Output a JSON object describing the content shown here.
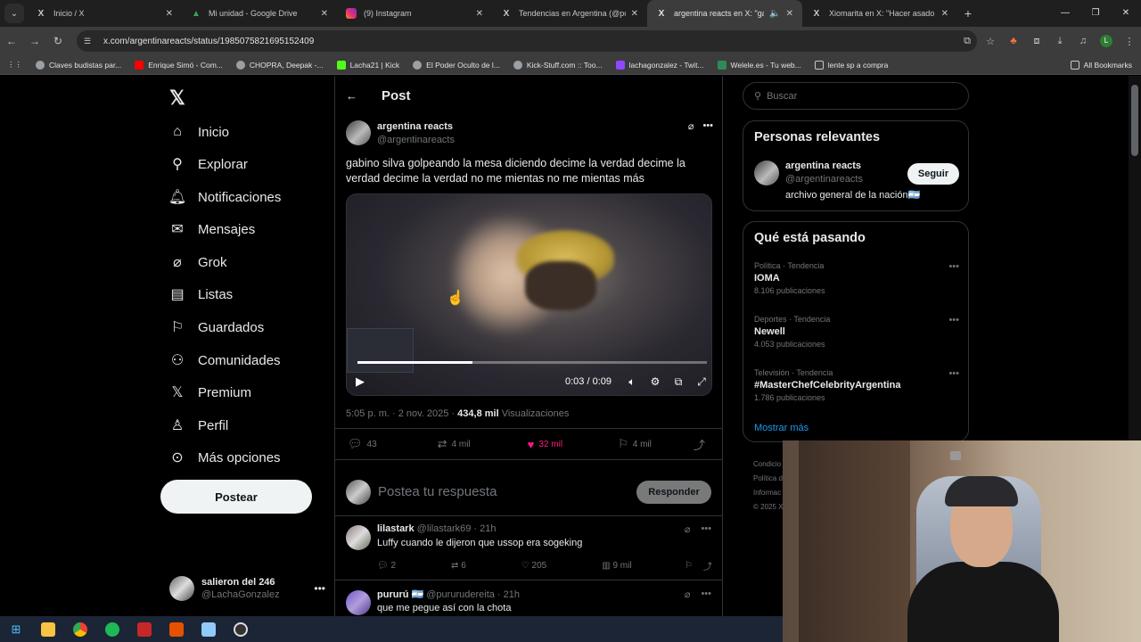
{
  "browser": {
    "tabs": [
      {
        "label": "Inicio / X",
        "icon": "x-logo-icon"
      },
      {
        "label": "Mi unidad - Google Drive",
        "icon": "google-drive-icon"
      },
      {
        "label": "(9) Instagram",
        "icon": "instagram-icon"
      },
      {
        "label": "Tendencias en Argentina (@po",
        "icon": "x-logo-icon"
      },
      {
        "label": "argentina reacts en X: \"gab",
        "icon": "x-logo-icon",
        "active": true
      },
      {
        "label": "Xiomarita en X: \"Hacer asado c",
        "icon": "x-logo-icon"
      }
    ],
    "url": "x.com/argentinareacts/status/1985075821695152409",
    "bookmarks": [
      {
        "label": "Claves budistas par...",
        "color": "#9aa0a6"
      },
      {
        "label": "Enrique Simó - Com...",
        "color": "#ff0000"
      },
      {
        "label": "CHOPRA, Deepak -...",
        "color": "#9aa0a6"
      },
      {
        "label": "Lacha21 | Kick",
        "color": "#53fc18"
      },
      {
        "label": "El Poder Oculto de l...",
        "color": "#9aa0a6"
      },
      {
        "label": "Kick-Stuff.com :: Too...",
        "color": "#9aa0a6"
      },
      {
        "label": "lachagonzalez - Twit...",
        "color": "#9146ff"
      },
      {
        "label": "Welele.es - Tu web...",
        "color": "#2e8b57"
      },
      {
        "label": "lente sp a compra",
        "color": "#c7c7c7"
      }
    ],
    "all_bookmarks": "All Bookmarks"
  },
  "nav": {
    "items": [
      {
        "label": "Inicio",
        "icon": "home-icon"
      },
      {
        "label": "Explorar",
        "icon": "search-icon"
      },
      {
        "label": "Notificaciones",
        "icon": "bell-icon"
      },
      {
        "label": "Mensajes",
        "icon": "mail-icon"
      },
      {
        "label": "Grok",
        "icon": "grok-icon"
      },
      {
        "label": "Listas",
        "icon": "list-icon"
      },
      {
        "label": "Guardados",
        "icon": "bookmark-icon"
      },
      {
        "label": "Comunidades",
        "icon": "people-icon"
      },
      {
        "label": "Premium",
        "icon": "x-logo-icon"
      },
      {
        "label": "Perfil",
        "icon": "user-icon"
      },
      {
        "label": "Más opciones",
        "icon": "more-circle-icon"
      }
    ],
    "post_button": "Postear",
    "profile": {
      "name": "salieron del 246",
      "handle": "@LachaGonzalez"
    }
  },
  "main": {
    "header_title": "Post",
    "post": {
      "author": "argentina reacts",
      "handle": "@argentinareacts",
      "text": "gabino silva golpeando la mesa diciendo decime la verdad decime la verdad decime la verdad no me mientas no me mientas más",
      "video": {
        "time": "0:03 / 0:09",
        "progress": 0.33
      },
      "timestamp": "5:05 p. m. · 2 nov. 2025 · ",
      "views_count": "434,8 mil",
      "views_label": "Visualizaciones",
      "stats": {
        "replies": "43",
        "reposts": "4 mil",
        "likes": "32 mil",
        "bookmarks": "4 mil"
      }
    },
    "reply": {
      "placeholder": "Postea tu respuesta",
      "button": "Responder"
    },
    "comments": [
      {
        "name": "lilastark",
        "handle": "@lilastark69 · 21h",
        "text": "Luffy cuando le dijeron que ussop era sogeking",
        "replies": "2",
        "reposts": "6",
        "likes": "205",
        "views": "9 mil"
      },
      {
        "name": "pururú 🇦🇷",
        "handle": "@pururudereita · 21h",
        "text": "que me pegue así con la chota"
      }
    ]
  },
  "right": {
    "search_placeholder": "Buscar",
    "relevant": {
      "title": "Personas relevantes",
      "name": "argentina reacts",
      "handle": "@argentinareacts",
      "bio": "archivo general de la nación🇦🇷",
      "follow": "Seguir"
    },
    "trends": {
      "title": "Qué está pasando",
      "items": [
        {
          "category": "Política · Tendencia",
          "name": "IOMA",
          "posts": "8.106 publicaciones"
        },
        {
          "category": "Deportes · Tendencia",
          "name": "Newell",
          "posts": "4.053 publicaciones"
        },
        {
          "category": "Televisión · Tendencia",
          "name": "#MasterChefCelebrityArgentina",
          "posts": "1.786 publicaciones"
        }
      ],
      "show_more": "Mostrar más"
    },
    "footer": [
      "Condicio",
      "Política d",
      "Informac",
      "© 2025 X"
    ]
  }
}
